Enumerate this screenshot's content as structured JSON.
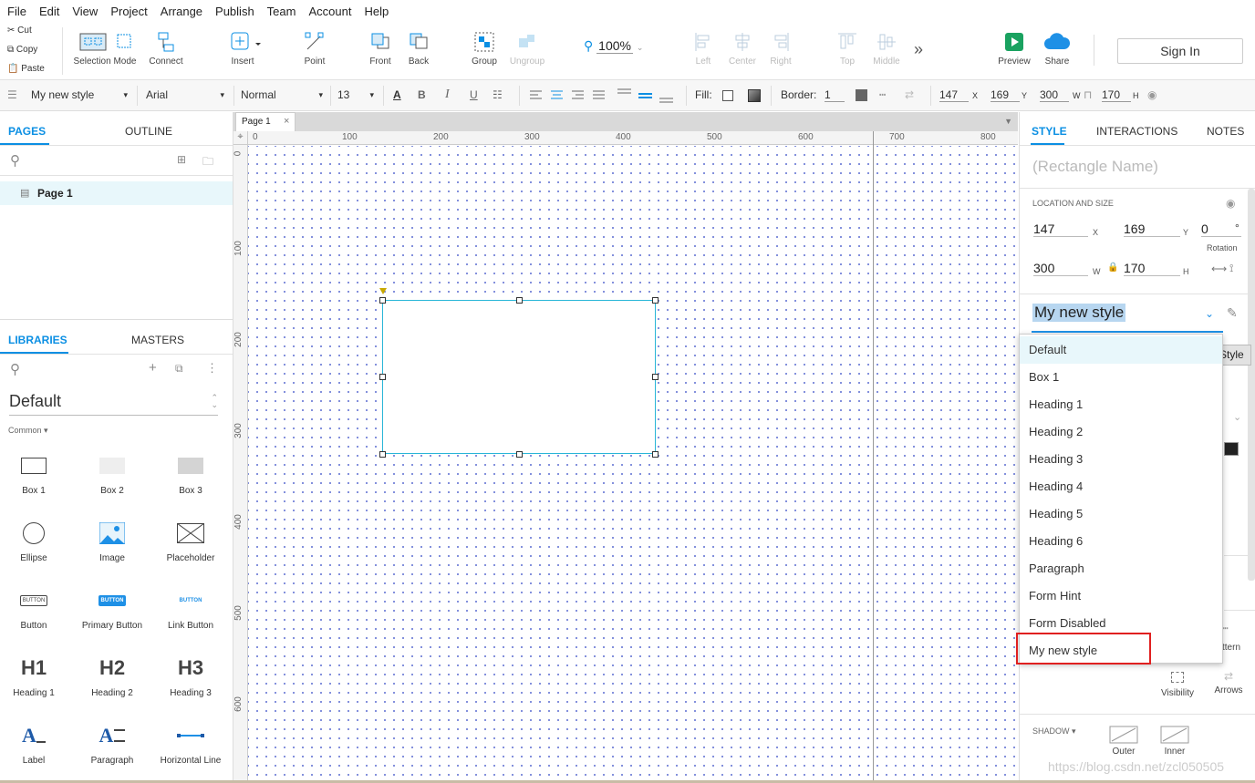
{
  "menu": [
    "File",
    "Edit",
    "View",
    "Project",
    "Arrange",
    "Publish",
    "Team",
    "Account",
    "Help"
  ],
  "clipboard": {
    "cut": "Cut",
    "copy": "Copy",
    "paste": "Paste"
  },
  "toolbar": {
    "selection_mode": "Selection Mode",
    "connect": "Connect",
    "insert": "Insert",
    "point": "Point",
    "front": "Front",
    "back": "Back",
    "group": "Group",
    "ungroup": "Ungroup",
    "zoom": "100%",
    "left": "Left",
    "center": "Center",
    "right": "Right",
    "top": "Top",
    "middle": "Middle",
    "preview": "Preview",
    "share": "Share",
    "sign_in": "Sign In"
  },
  "format": {
    "style": "My new style",
    "font": "Arial",
    "weight": "Normal",
    "size": "13",
    "fill_label": "Fill:",
    "border_label": "Border:",
    "border_value": "1",
    "x": "147",
    "x_unit": "X",
    "y": "169",
    "y_unit": "Y",
    "w": "300",
    "w_unit": "W",
    "h": "170",
    "h_unit": "H"
  },
  "left_panel": {
    "pages_tab": "PAGES",
    "outline_tab": "OUTLINE",
    "page_item": "Page 1",
    "libraries_tab": "LIBRARIES",
    "masters_tab": "MASTERS",
    "library_name": "Default",
    "category": "Common ▾",
    "items": [
      {
        "label": "Box 1"
      },
      {
        "label": "Box 2"
      },
      {
        "label": "Box 3"
      },
      {
        "label": "Ellipse"
      },
      {
        "label": "Image"
      },
      {
        "label": "Placeholder"
      },
      {
        "label": "Button"
      },
      {
        "label": "Primary Button"
      },
      {
        "label": "Link Button"
      },
      {
        "label": "Heading 1"
      },
      {
        "label": "Heading 2"
      },
      {
        "label": "Heading 3"
      },
      {
        "label": "Label"
      },
      {
        "label": "Paragraph"
      },
      {
        "label": "Horizontal Line"
      }
    ],
    "icon_text": {
      "button": "BUTTON",
      "h1": "H1",
      "h2": "H2",
      "h3": "H3",
      "label": "A",
      "paragraph": "A"
    }
  },
  "canvas": {
    "tab": "Page 1",
    "ruler_h": [
      "0",
      "100",
      "200",
      "300",
      "400",
      "500",
      "600",
      "700",
      "800"
    ],
    "ruler_v": [
      "0",
      "100",
      "200",
      "300",
      "400",
      "500",
      "600"
    ]
  },
  "right_panel": {
    "style_tab": "STYLE",
    "interactions_tab": "INTERACTIONS",
    "notes_tab": "NOTES",
    "name_placeholder": "(Rectangle Name)",
    "location_header": "LOCATION AND SIZE",
    "x": "147",
    "y": "169",
    "rotation": "0",
    "rotation_unit": "°",
    "rotation_label": "Rotation",
    "w": "300",
    "h": "170",
    "x_unit": "X",
    "y_unit": "Y",
    "w_unit": "W",
    "h_unit": "H",
    "widget_style": "My new style",
    "tooltip": "Widget Style",
    "visibility": "Visibility",
    "arrows": "Arrows",
    "pattern": "ttern",
    "shadow": "SHADOW ▾",
    "outer": "Outer",
    "inner": "Inner"
  },
  "style_dropdown": [
    "Default",
    "Box 1",
    "Heading 1",
    "Heading 2",
    "Heading 3",
    "Heading 4",
    "Heading 5",
    "Heading 6",
    "Paragraph",
    "Form Hint",
    "Form Disabled",
    "My new style"
  ],
  "watermark": "https://blog.csdn.net/zcl050505",
  "colors": {
    "accent": "#0b8fe3",
    "selection": "#29b6d8",
    "highlight": "#e8f7fb",
    "red": "#e02020"
  }
}
